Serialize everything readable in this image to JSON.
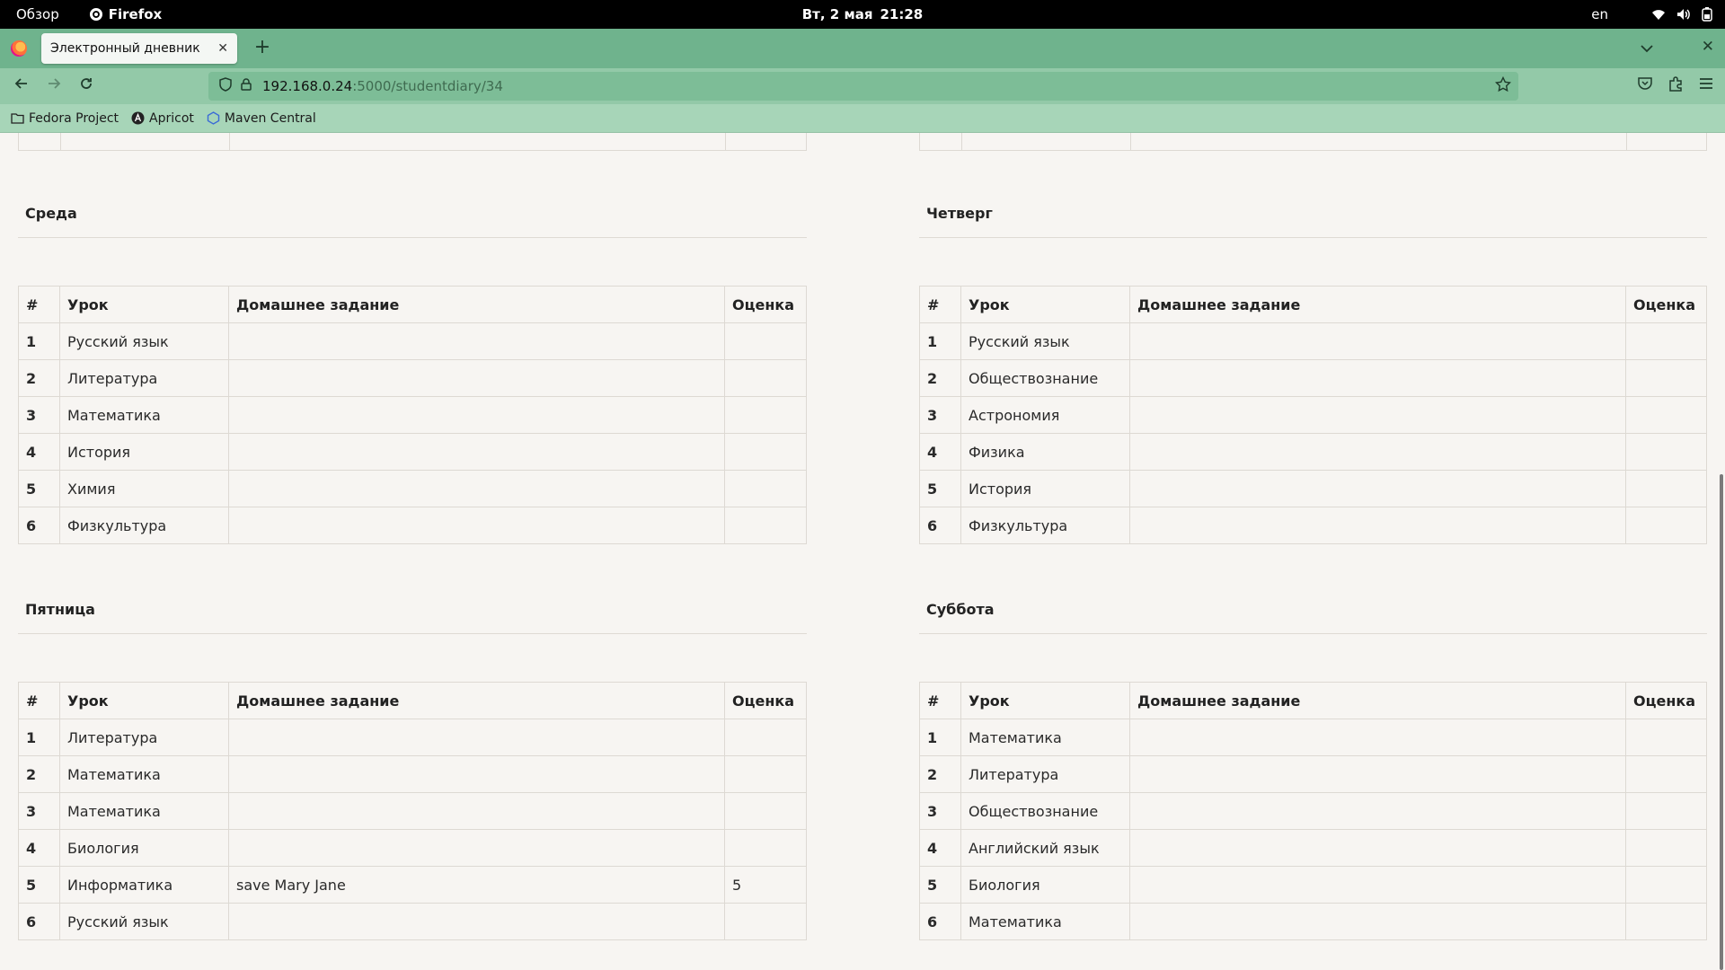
{
  "system_bar": {
    "overview": "Обзор",
    "app_name": "Firefox",
    "date": "Вт, 2 мая",
    "time": "21:28",
    "language": "en"
  },
  "browser": {
    "tab_title": "Электронный дневник",
    "url_host": "192.168.0.24",
    "url_path": ":5000/studentdiary/34",
    "bookmarks": [
      "Fedora Project",
      "Apricot",
      "Maven Central"
    ]
  },
  "table_headers": {
    "num": "#",
    "lesson": "Урок",
    "homework": "Домашнее задание",
    "grade": "Оценка"
  },
  "days": [
    {
      "name": "Среда",
      "rows": [
        {
          "num": "1",
          "lesson": "Русский язык",
          "homework": "",
          "grade": ""
        },
        {
          "num": "2",
          "lesson": "Литература",
          "homework": "",
          "grade": ""
        },
        {
          "num": "3",
          "lesson": "Математика",
          "homework": "",
          "grade": ""
        },
        {
          "num": "4",
          "lesson": "История",
          "homework": "",
          "grade": ""
        },
        {
          "num": "5",
          "lesson": "Химия",
          "homework": "",
          "grade": ""
        },
        {
          "num": "6",
          "lesson": "Физкультура",
          "homework": "",
          "grade": ""
        }
      ]
    },
    {
      "name": "Четверг",
      "rows": [
        {
          "num": "1",
          "lesson": "Русский язык",
          "homework": "",
          "grade": ""
        },
        {
          "num": "2",
          "lesson": "Обществознание",
          "homework": "",
          "grade": ""
        },
        {
          "num": "3",
          "lesson": "Астрономия",
          "homework": "",
          "grade": ""
        },
        {
          "num": "4",
          "lesson": "Физика",
          "homework": "",
          "grade": ""
        },
        {
          "num": "5",
          "lesson": "История",
          "homework": "",
          "grade": ""
        },
        {
          "num": "6",
          "lesson": "Физкультура",
          "homework": "",
          "grade": ""
        }
      ]
    },
    {
      "name": "Пятница",
      "rows": [
        {
          "num": "1",
          "lesson": "Литература",
          "homework": "",
          "grade": ""
        },
        {
          "num": "2",
          "lesson": "Математика",
          "homework": "",
          "grade": ""
        },
        {
          "num": "3",
          "lesson": "Математика",
          "homework": "",
          "grade": ""
        },
        {
          "num": "4",
          "lesson": "Биология",
          "homework": "",
          "grade": ""
        },
        {
          "num": "5",
          "lesson": "Информатика",
          "homework": "save Mary Jane",
          "grade": "5"
        },
        {
          "num": "6",
          "lesson": "Русский язык",
          "homework": "",
          "grade": ""
        }
      ]
    },
    {
      "name": "Суббота",
      "rows": [
        {
          "num": "1",
          "lesson": "Математика",
          "homework": "",
          "grade": ""
        },
        {
          "num": "2",
          "lesson": "Литература",
          "homework": "",
          "grade": ""
        },
        {
          "num": "3",
          "lesson": "Обществознание",
          "homework": "",
          "grade": ""
        },
        {
          "num": "4",
          "lesson": "Английский язык",
          "homework": "",
          "grade": ""
        },
        {
          "num": "5",
          "lesson": "Биология",
          "homework": "",
          "grade": ""
        },
        {
          "num": "6",
          "lesson": "Математика",
          "homework": "",
          "grade": ""
        }
      ]
    }
  ]
}
